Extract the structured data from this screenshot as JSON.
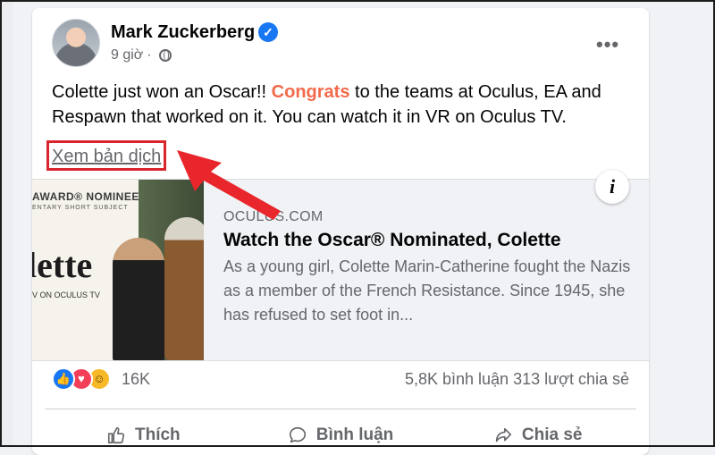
{
  "post": {
    "author": "Mark Zuckerberg",
    "time": "9 giờ",
    "separator": "·",
    "text_before": "Colette just won an Oscar!! ",
    "text_highlight": "Congrats",
    "text_after": " to the teams at Oculus, EA and Respawn that worked on it. You can watch it in VR on Oculus TV.",
    "translate_label": "Xem bản dịch",
    "more_label": "•••"
  },
  "link_preview": {
    "domain": "OCULUS.COM",
    "title": "Watch the Oscar® Nominated, Colette",
    "description": "As a young girl, Colette Marin-Catherine fought the Nazis as a member of the French Resistance. Since 1945, she has refused to set foot in...",
    "thumbnail": {
      "award_line": "AWARD® NOMINEE",
      "award_sub": "ENTARY SHORT SUBJECT",
      "title": "lette",
      "sub": "V ON OCULUS TV"
    },
    "info_label": "i"
  },
  "engagement": {
    "reaction_count": "16K",
    "comments": "5,8K bình luận",
    "shares": "313 lượt chia sẻ"
  },
  "actions": {
    "like": "Thích",
    "comment": "Bình luận",
    "share": "Chia sẻ"
  },
  "colors": {
    "accent": "#1877f2",
    "highlight_red": "#d8262c",
    "congrats": "#f26a4b"
  }
}
